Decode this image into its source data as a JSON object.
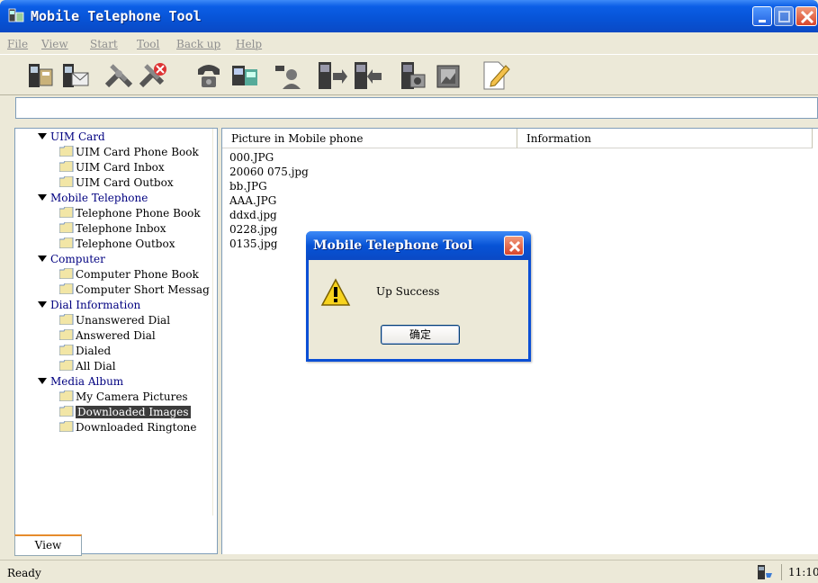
{
  "window": {
    "title": "Mobile Telephone Tool"
  },
  "menu": [
    "File",
    "View",
    "Start",
    "Tool",
    "Back up",
    "Help"
  ],
  "toolbar": {
    "buttons": [
      "phone-book-icon",
      "sms-icon",
      "connect-icon",
      "disconnect-icon",
      "dial-icon",
      "sync-icon",
      "contact-icon",
      "upload-icon",
      "download-icon",
      "camera-icon",
      "album-icon",
      "edit-icon"
    ]
  },
  "tree": [
    {
      "label": "UIM Card",
      "type": "category"
    },
    {
      "label": "UIM Card Phone Book",
      "type": "folder"
    },
    {
      "label": "UIM Card Inbox",
      "type": "folder"
    },
    {
      "label": "UIM Card Outbox",
      "type": "folder"
    },
    {
      "label": "Mobile Telephone",
      "type": "category"
    },
    {
      "label": "Telephone Phone Book",
      "type": "folder"
    },
    {
      "label": "Telephone Inbox",
      "type": "folder"
    },
    {
      "label": "Telephone Outbox",
      "type": "folder"
    },
    {
      "label": "Computer",
      "type": "category"
    },
    {
      "label": "Computer Phone Book",
      "type": "folder"
    },
    {
      "label": "Computer Short Messag",
      "type": "folder"
    },
    {
      "label": "Dial Information",
      "type": "category"
    },
    {
      "label": "Unanswered Dial",
      "type": "folder"
    },
    {
      "label": "Answered Dial",
      "type": "folder"
    },
    {
      "label": "Dialed",
      "type": "folder"
    },
    {
      "label": "All Dial",
      "type": "folder"
    },
    {
      "label": "Media Album",
      "type": "category"
    },
    {
      "label": "My Camera Pictures",
      "type": "folder"
    },
    {
      "label": "Downloaded Images",
      "type": "folder",
      "selected": true
    },
    {
      "label": "Downloaded Ringtone",
      "type": "folder"
    }
  ],
  "left_tab": "View",
  "list": {
    "columns": [
      "Picture in Mobile phone",
      "Information"
    ],
    "files": [
      "000.JPG",
      "20060 075.jpg",
      "bb.JPG",
      "AAA.JPG",
      "ddxd.jpg",
      "0228.jpg",
      "0135.jpg"
    ]
  },
  "status": {
    "text": "Ready",
    "time": "11:10"
  },
  "dialog": {
    "title": "Mobile Telephone Tool",
    "message": "Up Success",
    "ok_label": "确定"
  }
}
